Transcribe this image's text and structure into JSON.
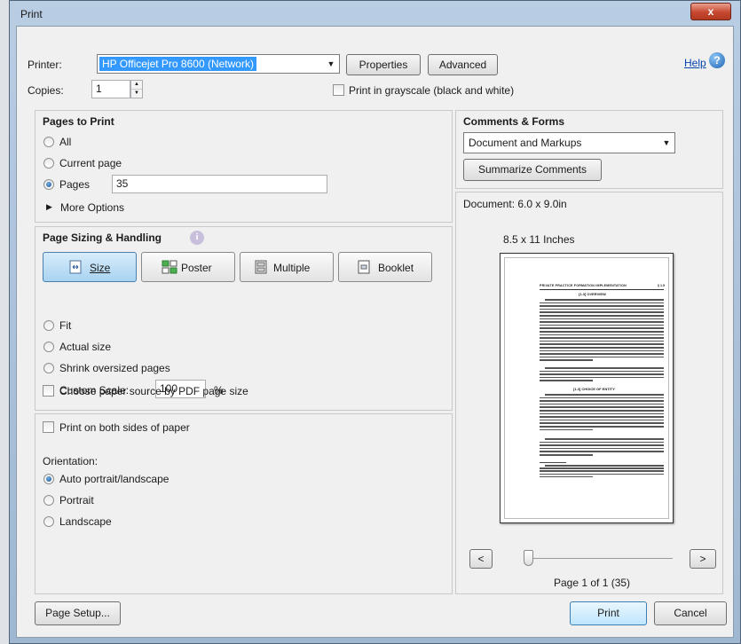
{
  "window": {
    "title": "Print",
    "close_glyph": "x"
  },
  "printer": {
    "label": "Printer:",
    "selected": "HP Officejet Pro 8600 (Network)",
    "properties_button": "Properties",
    "advanced_button": "Advanced",
    "help_link": "Help",
    "copies_label": "Copies:",
    "copies_value": "1",
    "grayscale_label": "Print in grayscale (black and white)",
    "grayscale_checked": false
  },
  "pages_to_print": {
    "title": "Pages to Print",
    "all_label": "All",
    "current_label": "Current page",
    "pages_label": "Pages",
    "pages_value": "35",
    "selected": "pages",
    "more_options": "More Options"
  },
  "sizing": {
    "title": "Page Sizing & Handling",
    "buttons": [
      "Size",
      "Poster",
      "Multiple",
      "Booklet"
    ],
    "active_button": "Size",
    "fit_label": "Fit",
    "actual_label": "Actual size",
    "shrink_label": "Shrink oversized pages",
    "custom_label": "Custom Scale:",
    "custom_value": "100",
    "percent": "%",
    "selected": "custom",
    "paper_source_label": "Choose paper source by PDF page size"
  },
  "duplex": {
    "label": "Print on both sides of paper",
    "orientation_label": "Orientation:",
    "auto_label": "Auto portrait/landscape",
    "portrait_label": "Portrait",
    "landscape_label": "Landscape",
    "selected": "auto"
  },
  "comments_forms": {
    "title": "Comments & Forms",
    "selected": "Document and Markups",
    "summarize_button": "Summarize Comments"
  },
  "preview": {
    "document_size": "Document: 6.0 x 9.0in",
    "paper_size": "8.5 x 11 Inches",
    "prev_button": "<",
    "next_button": ">",
    "page_indicator": "Page 1 of 1 (35)",
    "slider_position": 0,
    "doc_header": "PRIVATE PRACTICE FORMATION IMPLEMENTATION",
    "doc_header_num": "§ 1.5",
    "doc_section1": "[1.3] OVERVIEW",
    "doc_section2": "[1.3] CHOICE OF ENTITY"
  },
  "footer": {
    "page_setup_button": "Page Setup...",
    "print_button": "Print",
    "cancel_button": "Cancel"
  },
  "colors": {
    "title_gradient": "#b9cde3",
    "close": "#c6472e",
    "primary_button": "#bee6fd",
    "selection": "#3399ff"
  }
}
